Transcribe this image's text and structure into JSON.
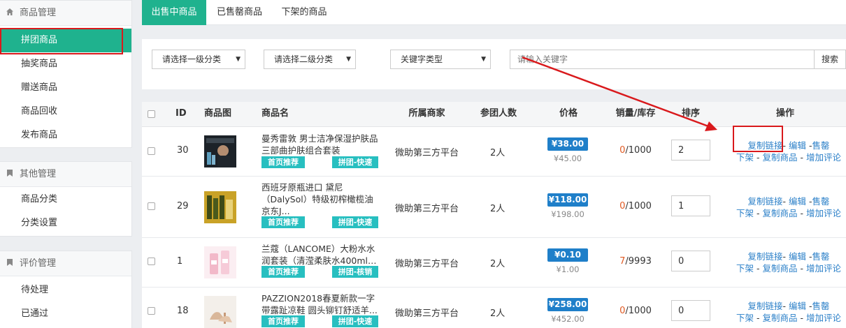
{
  "sidebar": {
    "groups": [
      {
        "title": "商品管理",
        "icon": "home-icon",
        "items": [
          "拼团商品",
          "抽奖商品",
          "赠送商品",
          "商品回收",
          "发布商品"
        ],
        "active": 0
      },
      {
        "title": "其他管理",
        "icon": "bookmark-icon",
        "items": [
          "商品分类",
          "分类设置"
        ]
      },
      {
        "title": "评价管理",
        "icon": "bookmark-icon",
        "items": [
          "待处理",
          "已通过"
        ]
      }
    ]
  },
  "tabs": [
    {
      "label": "出售中商品",
      "active": true
    },
    {
      "label": "已售罄商品"
    },
    {
      "label": "下架的商品"
    }
  ],
  "filters": {
    "category1": "请选择一级分类",
    "category2": "请选择二级分类",
    "keyword_type": "关键字类型",
    "keyword_placeholder": "请输入关键字",
    "search_label": "搜索"
  },
  "table": {
    "headers": {
      "id": "ID",
      "image": "商品图",
      "name": "商品名",
      "merchant": "所属商家",
      "participants": "参团人数",
      "price": "价格",
      "sales_stock": "销量/库存",
      "sort": "排序",
      "actions": "操作"
    },
    "rows": [
      {
        "id": "30",
        "name_line1": "曼秀雷敦 男士洁净保湿护肤品",
        "name_line2": "三部曲护肤组合套装",
        "tag_home": "首页推荐",
        "tag_group": "拼团-快速",
        "merchant": "微助第三方平台",
        "participants": "2人",
        "price": "¥38.00",
        "orig_price": "¥45.00",
        "sold": "0",
        "stock": "/1000",
        "sort": "2"
      },
      {
        "id": "29",
        "name_line1": "西班牙原瓶进口 黛尼",
        "name_line2": "（DalySol）特级初榨橄榄油",
        "name_line3": "京东J...",
        "tag_home": "首页推荐",
        "tag_group": "拼团-快速",
        "merchant": "微助第三方平台",
        "participants": "2人",
        "price": "¥118.00",
        "orig_price": "¥198.00",
        "sold": "0",
        "stock": "/1000",
        "sort": "1"
      },
      {
        "id": "1",
        "name_line1": "兰蔻（LANCOME）大粉水水",
        "name_line2": "润套装（清滢柔肤水400ml+...",
        "tag_home": "首页推荐",
        "tag_group": "拼团-核销",
        "merchant": "微助第三方平台",
        "participants": "2人",
        "price": "¥0.10",
        "orig_price": "¥1.00",
        "sold": "7",
        "stock": "/9993",
        "sort": "0"
      },
      {
        "id": "18",
        "name_line1": "PAZZION2018春夏新款一字",
        "name_line2": "带露趾凉鞋 圆头铆钉舒适羊...",
        "tag_home": "首页推荐",
        "tag_group": "拼团-快速",
        "merchant": "微助第三方平台",
        "participants": "2人",
        "price": "¥258.00",
        "orig_price": "¥452.00",
        "sold": "0",
        "stock": "/1000",
        "sort": "0"
      }
    ],
    "actions": {
      "copy_link": "复制链接",
      "edit": "编辑",
      "sellout": "售罄",
      "offshelf": "下架",
      "copy_goods": "复制商品",
      "add_comment": "增加评论"
    }
  },
  "colors": {
    "accent": "#1fb28e",
    "price_badge": "#1f7fc9",
    "tag": "#27bfc0",
    "link": "#2a7fc8",
    "annotation": "#d9191c"
  }
}
